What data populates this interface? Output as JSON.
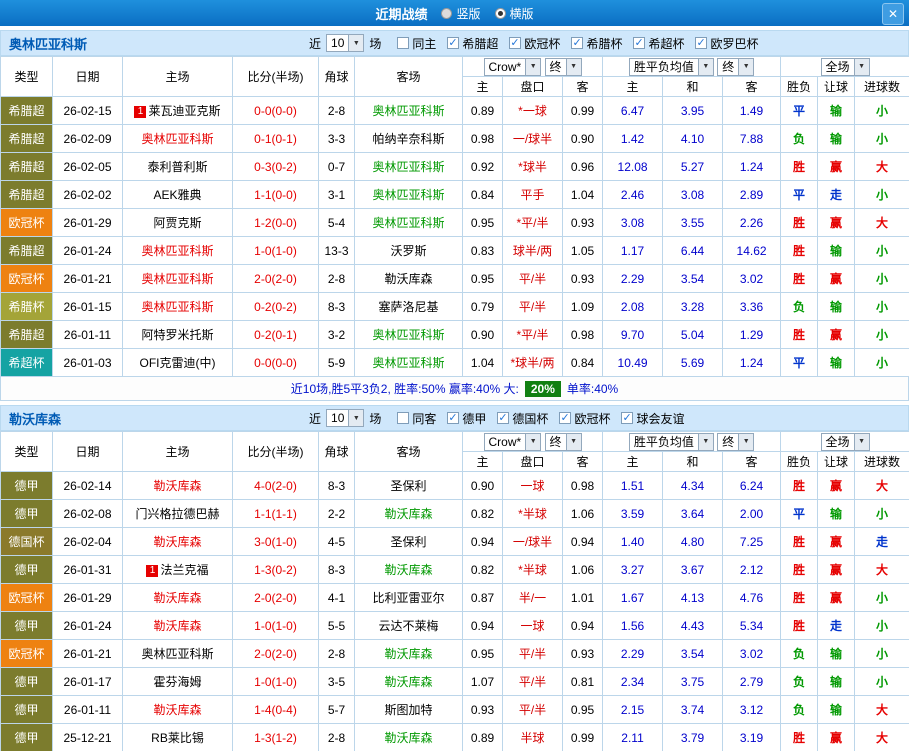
{
  "topbar": {
    "title": "近期战绩",
    "radios": [
      {
        "label": "竖版",
        "selected": false
      },
      {
        "label": "横版",
        "selected": true
      }
    ],
    "close_icon": "✕"
  },
  "dropdowns": {
    "games_count": "10",
    "bookmaker": "Crow*",
    "odds_stage1": "终",
    "avg_type": "胜平负均值",
    "odds_stage2": "终",
    "scope": "全场"
  },
  "table_header": {
    "type": "类型",
    "date": "日期",
    "home": "主场",
    "score": "比分(半场)",
    "corner": "角球",
    "away": "客场",
    "odds_home": "主",
    "odds_line": "盘口",
    "odds_away": "客",
    "avg_home": "主",
    "avg_draw": "和",
    "avg_away": "客",
    "result": "胜负",
    "handicap": "让球",
    "goals": "进球数"
  },
  "colors": {
    "topbar_blue": "#0f7fd0",
    "section_header_bg": "#cfe7fb",
    "focus_home_red": "#e60000",
    "focus_away_green": "#009900",
    "draw_blue": "#0033cc",
    "league_olive": "#7c7c2d",
    "league_orange": "#ee8211",
    "league_ygreen": "#a4a438",
    "league_teal": "#15a3a3",
    "league_brown": "#8b7a2b",
    "summary_badge_green": "#128012"
  },
  "sections": [
    {
      "team": "奥林匹亚科斯",
      "near_label": "近",
      "games_label": "场",
      "checkboxes": [
        {
          "label": "同主",
          "checked": false
        },
        {
          "label": "希腊超",
          "checked": true
        },
        {
          "label": "欧冠杯",
          "checked": true
        },
        {
          "label": "希腊杯",
          "checked": true
        },
        {
          "label": "希超杯",
          "checked": true
        },
        {
          "label": "欧罗巴杯",
          "checked": true
        }
      ],
      "rows": [
        {
          "lg": "希腊超",
          "lgc": "olive",
          "date": "26-02-15",
          "hb": "1",
          "home": "莱瓦迪亚克斯",
          "home_c": "k",
          "score": "0-0(0-0)",
          "corner": "2-8",
          "away": "奥林匹亚科斯",
          "away_c": "g",
          "oh": "0.89",
          "line": "*一球",
          "oa": "0.99",
          "ah": "6.47",
          "ad": "3.95",
          "aa": "1.49",
          "res": "平",
          "res_c": "b",
          "hc": "输",
          "hc_c": "g",
          "gl": "小",
          "gl_c": "g"
        },
        {
          "lg": "希腊超",
          "lgc": "olive",
          "date": "26-02-09",
          "hb": "",
          "home": "奥林匹亚科斯",
          "home_c": "r",
          "score": "0-1(0-1)",
          "corner": "3-3",
          "away": "帕纳辛奈科斯",
          "away_c": "k",
          "oh": "0.98",
          "line": "一/球半",
          "oa": "0.90",
          "ah": "1.42",
          "ad": "4.10",
          "aa": "7.88",
          "res": "负",
          "res_c": "g",
          "hc": "输",
          "hc_c": "g",
          "gl": "小",
          "gl_c": "g"
        },
        {
          "lg": "希腊超",
          "lgc": "olive",
          "date": "26-02-05",
          "hb": "",
          "home": "泰利普利斯",
          "home_c": "k",
          "score": "0-3(0-2)",
          "corner": "0-7",
          "away": "奥林匹亚科斯",
          "away_c": "g",
          "oh": "0.92",
          "line": "*球半",
          "oa": "0.96",
          "ah": "12.08",
          "ad": "5.27",
          "aa": "1.24",
          "res": "胜",
          "res_c": "r",
          "hc": "赢",
          "hc_c": "r",
          "gl": "大",
          "gl_c": "r"
        },
        {
          "lg": "希腊超",
          "lgc": "olive",
          "date": "26-02-02",
          "hb": "",
          "home": "AEK雅典",
          "home_c": "k",
          "score": "1-1(0-0)",
          "corner": "3-1",
          "away": "奥林匹亚科斯",
          "away_c": "g",
          "oh": "0.84",
          "line": "平手",
          "oa": "1.04",
          "ah": "2.46",
          "ad": "3.08",
          "aa": "2.89",
          "res": "平",
          "res_c": "b",
          "hc": "走",
          "hc_c": "b",
          "gl": "小",
          "gl_c": "g"
        },
        {
          "lg": "欧冠杯",
          "lgc": "orange",
          "date": "26-01-29",
          "hb": "",
          "home": "阿贾克斯",
          "home_c": "k",
          "score": "1-2(0-0)",
          "corner": "5-4",
          "away": "奥林匹亚科斯",
          "away_c": "g",
          "oh": "0.95",
          "line": "*平/半",
          "oa": "0.93",
          "ah": "3.08",
          "ad": "3.55",
          "aa": "2.26",
          "res": "胜",
          "res_c": "r",
          "hc": "赢",
          "hc_c": "r",
          "gl": "大",
          "gl_c": "r"
        },
        {
          "lg": "希腊超",
          "lgc": "olive",
          "date": "26-01-24",
          "hb": "",
          "home": "奥林匹亚科斯",
          "home_c": "r",
          "score": "1-0(1-0)",
          "corner": "13-3",
          "away": "沃罗斯",
          "away_c": "k",
          "oh": "0.83",
          "line": "球半/两",
          "oa": "1.05",
          "ah": "1.17",
          "ad": "6.44",
          "aa": "14.62",
          "res": "胜",
          "res_c": "r",
          "hc": "输",
          "hc_c": "g",
          "gl": "小",
          "gl_c": "g"
        },
        {
          "lg": "欧冠杯",
          "lgc": "orange",
          "date": "26-01-21",
          "hb": "",
          "home": "奥林匹亚科斯",
          "home_c": "r",
          "score": "2-0(2-0)",
          "corner": "2-8",
          "away": "勒沃库森",
          "away_c": "k",
          "oh": "0.95",
          "line": "平/半",
          "oa": "0.93",
          "ah": "2.29",
          "ad": "3.54",
          "aa": "3.02",
          "res": "胜",
          "res_c": "r",
          "hc": "赢",
          "hc_c": "r",
          "gl": "小",
          "gl_c": "g"
        },
        {
          "lg": "希腊杯",
          "lgc": "ygreen",
          "date": "26-01-15",
          "hb": "",
          "home": "奥林匹亚科斯",
          "home_c": "r",
          "score": "0-2(0-2)",
          "corner": "8-3",
          "away": "塞萨洛尼基",
          "away_c": "k",
          "oh": "0.79",
          "line": "平/半",
          "oa": "1.09",
          "ah": "2.08",
          "ad": "3.28",
          "aa": "3.36",
          "res": "负",
          "res_c": "g",
          "hc": "输",
          "hc_c": "g",
          "gl": "小",
          "gl_c": "g"
        },
        {
          "lg": "希腊超",
          "lgc": "olive",
          "date": "26-01-11",
          "hb": "",
          "home": "阿特罗米托斯",
          "home_c": "k",
          "score": "0-2(0-1)",
          "corner": "3-2",
          "away": "奥林匹亚科斯",
          "away_c": "g",
          "oh": "0.90",
          "line": "*平/半",
          "oa": "0.98",
          "ah": "9.70",
          "ad": "5.04",
          "aa": "1.29",
          "res": "胜",
          "res_c": "r",
          "hc": "赢",
          "hc_c": "r",
          "gl": "小",
          "gl_c": "g"
        },
        {
          "lg": "希超杯",
          "lgc": "teal",
          "date": "26-01-03",
          "hb": "",
          "home": "OFI克雷迪(中)",
          "home_c": "k",
          "score": "0-0(0-0)",
          "corner": "5-9",
          "away": "奥林匹亚科斯",
          "away_c": "g",
          "oh": "1.04",
          "line": "*球半/两",
          "oa": "0.84",
          "ah": "10.49",
          "ad": "5.69",
          "aa": "1.24",
          "res": "平",
          "res_c": "b",
          "hc": "输",
          "hc_c": "g",
          "gl": "小",
          "gl_c": "g"
        }
      ],
      "summary": {
        "lead": "近10场,胜5平3负2, 胜率:50% 赢率:40% 大:",
        "badge": "20%",
        "tail": "单率:40%"
      }
    },
    {
      "team": "勒沃库森",
      "near_label": "近",
      "games_label": "场",
      "checkboxes": [
        {
          "label": "同客",
          "checked": false
        },
        {
          "label": "德甲",
          "checked": true
        },
        {
          "label": "德国杯",
          "checked": true
        },
        {
          "label": "欧冠杯",
          "checked": true
        },
        {
          "label": "球会友谊",
          "checked": true
        }
      ],
      "rows": [
        {
          "lg": "德甲",
          "lgc": "olive",
          "date": "26-02-14",
          "hb": "",
          "home": "勒沃库森",
          "home_c": "r",
          "score": "4-0(2-0)",
          "corner": "8-3",
          "away": "圣保利",
          "away_c": "k",
          "oh": "0.90",
          "line": "一球",
          "oa": "0.98",
          "ah": "1.51",
          "ad": "4.34",
          "aa": "6.24",
          "res": "胜",
          "res_c": "r",
          "hc": "赢",
          "hc_c": "r",
          "gl": "大",
          "gl_c": "r"
        },
        {
          "lg": "德甲",
          "lgc": "olive",
          "date": "26-02-08",
          "hb": "",
          "home": "门兴格拉德巴赫",
          "home_c": "k",
          "score": "1-1(1-1)",
          "corner": "2-2",
          "away": "勒沃库森",
          "away_c": "g",
          "oh": "0.82",
          "line": "*半球",
          "oa": "1.06",
          "ah": "3.59",
          "ad": "3.64",
          "aa": "2.00",
          "res": "平",
          "res_c": "b",
          "hc": "输",
          "hc_c": "g",
          "gl": "小",
          "gl_c": "g"
        },
        {
          "lg": "德国杯",
          "lgc": "brown",
          "date": "26-02-04",
          "hb": "",
          "home": "勒沃库森",
          "home_c": "r",
          "score": "3-0(1-0)",
          "corner": "4-5",
          "away": "圣保利",
          "away_c": "k",
          "oh": "0.94",
          "line": "一/球半",
          "oa": "0.94",
          "ah": "1.40",
          "ad": "4.80",
          "aa": "7.25",
          "res": "胜",
          "res_c": "r",
          "hc": "赢",
          "hc_c": "r",
          "gl": "走",
          "gl_c": "b"
        },
        {
          "lg": "德甲",
          "lgc": "olive",
          "date": "26-01-31",
          "hb": "1",
          "home": "法兰克福",
          "home_c": "k",
          "score": "1-3(0-2)",
          "corner": "8-3",
          "away": "勒沃库森",
          "away_c": "g",
          "oh": "0.82",
          "line": "*半球",
          "oa": "1.06",
          "ah": "3.27",
          "ad": "3.67",
          "aa": "2.12",
          "res": "胜",
          "res_c": "r",
          "hc": "赢",
          "hc_c": "r",
          "gl": "大",
          "gl_c": "r"
        },
        {
          "lg": "欧冠杯",
          "lgc": "orange",
          "date": "26-01-29",
          "hb": "",
          "home": "勒沃库森",
          "home_c": "r",
          "score": "2-0(2-0)",
          "corner": "4-1",
          "away": "比利亚雷亚尔",
          "away_c": "k",
          "oh": "0.87",
          "line": "半/一",
          "oa": "1.01",
          "ah": "1.67",
          "ad": "4.13",
          "aa": "4.76",
          "res": "胜",
          "res_c": "r",
          "hc": "赢",
          "hc_c": "r",
          "gl": "小",
          "gl_c": "g"
        },
        {
          "lg": "德甲",
          "lgc": "olive",
          "date": "26-01-24",
          "hb": "",
          "home": "勒沃库森",
          "home_c": "r",
          "score": "1-0(1-0)",
          "corner": "5-5",
          "away": "云达不莱梅",
          "away_c": "k",
          "oh": "0.94",
          "line": "一球",
          "oa": "0.94",
          "ah": "1.56",
          "ad": "4.43",
          "aa": "5.34",
          "res": "胜",
          "res_c": "r",
          "hc": "走",
          "hc_c": "b",
          "gl": "小",
          "gl_c": "g"
        },
        {
          "lg": "欧冠杯",
          "lgc": "orange",
          "date": "26-01-21",
          "hb": "",
          "home": "奥林匹亚科斯",
          "home_c": "k",
          "score": "2-0(2-0)",
          "corner": "2-8",
          "away": "勒沃库森",
          "away_c": "g",
          "oh": "0.95",
          "line": "平/半",
          "oa": "0.93",
          "ah": "2.29",
          "ad": "3.54",
          "aa": "3.02",
          "res": "负",
          "res_c": "g",
          "hc": "输",
          "hc_c": "g",
          "gl": "小",
          "gl_c": "g"
        },
        {
          "lg": "德甲",
          "lgc": "olive",
          "date": "26-01-17",
          "hb": "",
          "home": "霍芬海姆",
          "home_c": "k",
          "score": "1-0(1-0)",
          "corner": "3-5",
          "away": "勒沃库森",
          "away_c": "g",
          "oh": "1.07",
          "line": "平/半",
          "oa": "0.81",
          "ah": "2.34",
          "ad": "3.75",
          "aa": "2.79",
          "res": "负",
          "res_c": "g",
          "hc": "输",
          "hc_c": "g",
          "gl": "小",
          "gl_c": "g"
        },
        {
          "lg": "德甲",
          "lgc": "olive",
          "date": "26-01-11",
          "hb": "",
          "home": "勒沃库森",
          "home_c": "r",
          "score": "1-4(0-4)",
          "corner": "5-7",
          "away": "斯图加特",
          "away_c": "k",
          "oh": "0.93",
          "line": "平/半",
          "oa": "0.95",
          "ah": "2.15",
          "ad": "3.74",
          "aa": "3.12",
          "res": "负",
          "res_c": "g",
          "hc": "输",
          "hc_c": "g",
          "gl": "大",
          "gl_c": "r"
        },
        {
          "lg": "德甲",
          "lgc": "olive",
          "date": "25-12-21",
          "hb": "",
          "home": "RB莱比锡",
          "home_c": "k",
          "score": "1-3(1-2)",
          "corner": "2-8",
          "away": "勒沃库森",
          "away_c": "g",
          "oh": "0.89",
          "line": "半球",
          "oa": "0.99",
          "ah": "2.11",
          "ad": "3.79",
          "aa": "3.19",
          "res": "胜",
          "res_c": "r",
          "hc": "赢",
          "hc_c": "r",
          "gl": "大",
          "gl_c": "r"
        }
      ]
    }
  ]
}
